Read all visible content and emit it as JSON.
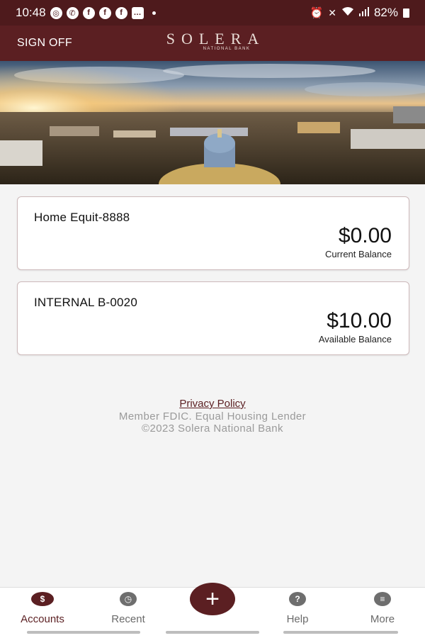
{
  "status_bar": {
    "time": "10:48",
    "battery": "82%"
  },
  "header": {
    "sign_off_label": "SIGN OFF",
    "logo_text": "SOLERA",
    "logo_subtext": "NATIONAL BANK"
  },
  "accounts": [
    {
      "name": "Home Equit-8888",
      "amount": "$0.00",
      "balance_label": "Current Balance"
    },
    {
      "name": "INTERNAL B-0020",
      "amount": "$10.00",
      "balance_label": "Available Balance"
    }
  ],
  "footer": {
    "privacy_policy": "Privacy Policy",
    "member_line": "Member FDIC. Equal Housing Lender",
    "copyright": "©2023 Solera National Bank"
  },
  "tabs": [
    {
      "label": "Accounts",
      "icon": "accounts-icon",
      "active": true
    },
    {
      "label": "Recent",
      "icon": "recent-clock-icon",
      "active": false
    },
    {
      "label": "Help",
      "icon": "help-question-icon",
      "active": false
    },
    {
      "label": "More",
      "icon": "more-menu-icon",
      "active": false
    }
  ],
  "fab_icon": "plus-icon",
  "colors": {
    "brand": "#5b1f22",
    "status_bar": "#4e1a1c",
    "background": "#f4f4f4",
    "muted_text": "#9a9a9a"
  }
}
